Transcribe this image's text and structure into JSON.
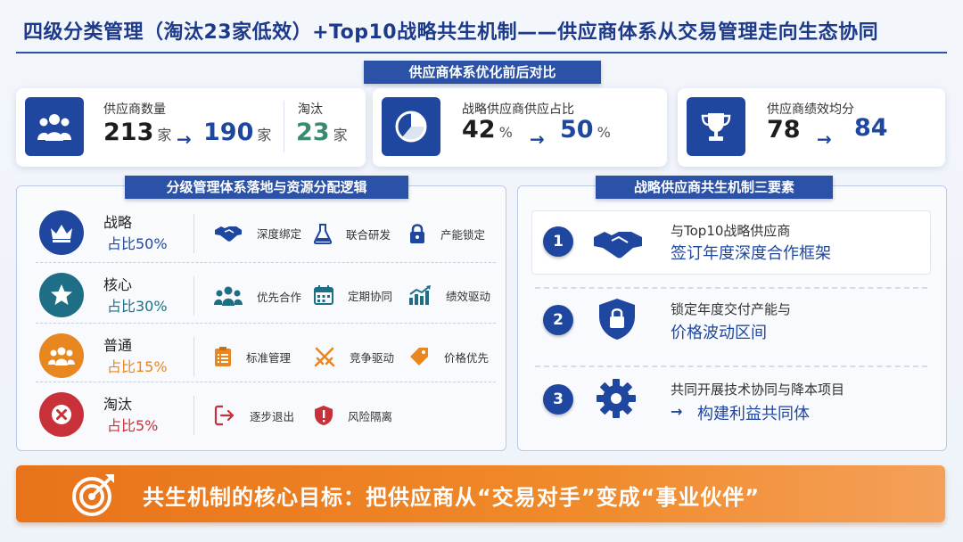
{
  "title": "四级分类管理（淘汰23家低效）+Top10战略共生机制——供应商体系从交易管理走向生态协同",
  "comparison": {
    "heading": "供应商体系优化前后对比",
    "supplier_count": {
      "label": "供应商数量",
      "before": "213",
      "after": "190",
      "unit": "家"
    },
    "eliminated": {
      "label": "淘汰",
      "value": "23",
      "unit": "家"
    },
    "strategic_share": {
      "label": "战略供应商供应占比",
      "before": "42",
      "after": "50",
      "unit": "%"
    },
    "performance": {
      "label": "供应商绩效均分",
      "before": "78",
      "after": "84"
    },
    "arrow": "→"
  },
  "tiers": {
    "heading": "分级管理体系落地与资源分配逻辑",
    "items": [
      {
        "name": "战略",
        "share": "占比50%",
        "color": "#1f47a0",
        "icon": "crown-icon",
        "features": [
          {
            "label": "深度绑定",
            "icon": "handshake-icon"
          },
          {
            "label": "联合研发",
            "icon": "flask-icon"
          },
          {
            "label": "产能锁定",
            "icon": "lock-icon"
          }
        ]
      },
      {
        "name": "核心",
        "share": "占比30%",
        "color": "#1e6f86",
        "icon": "star-icon",
        "features": [
          {
            "label": "优先合作",
            "icon": "group-icon"
          },
          {
            "label": "定期协同",
            "icon": "calendar-icon"
          },
          {
            "label": "绩效驱动",
            "icon": "bar-chart-icon"
          }
        ]
      },
      {
        "name": "普通",
        "share": "占比15%",
        "color": "#e8861f",
        "icon": "people-icon",
        "features": [
          {
            "label": "标准管理",
            "icon": "clipboard-icon"
          },
          {
            "label": "竞争驱动",
            "icon": "crossed-swords-icon"
          },
          {
            "label": "价格优先",
            "icon": "price-tag-icon"
          }
        ]
      },
      {
        "name": "淘汰",
        "share": "占比5%",
        "color": "#c8303a",
        "icon": "x-icon",
        "features": [
          {
            "label": "逐步退出",
            "icon": "exit-icon"
          },
          {
            "label": "风险隔离",
            "icon": "shield-alert-icon"
          }
        ]
      }
    ]
  },
  "elements": {
    "heading": "战略供应商共生机制三要素",
    "items": [
      {
        "num": "1",
        "line1": "与Top10战略供应商",
        "line2": "签订年度深度合作框架",
        "icon": "handshake-icon"
      },
      {
        "num": "2",
        "line1": "锁定年度交付产能与",
        "line2": "价格波动区间",
        "icon": "shield-lock-icon"
      },
      {
        "num": "3",
        "line1": "共同开展技术协同与降本项目",
        "line2": "构建利益共同体",
        "arrow": "→",
        "icon": "gear-icon"
      }
    ]
  },
  "banner": {
    "text": "共生机制的核心目标：把供应商从“交易对手”变成“事业伙伴”",
    "icon": "target-icon"
  }
}
